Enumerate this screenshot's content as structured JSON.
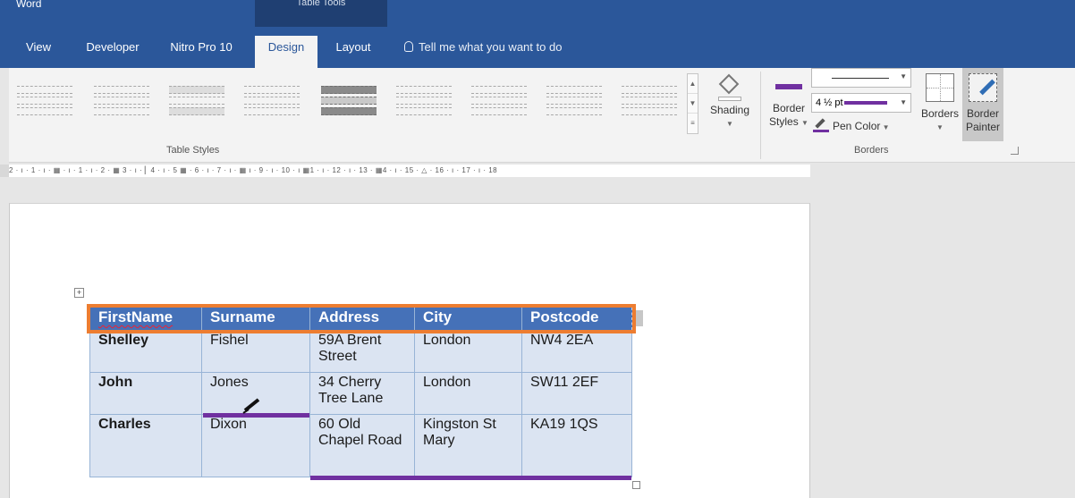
{
  "titlebar": {
    "app_name": "Word",
    "context_label": "Table Tools"
  },
  "tabs": [
    {
      "label": "View",
      "active": false
    },
    {
      "label": "Developer",
      "active": false
    },
    {
      "label": "Nitro Pro 10",
      "active": false
    },
    {
      "label": "Design",
      "active": true
    },
    {
      "label": "Layout",
      "active": false
    }
  ],
  "tell_me": "Tell me what you want to do",
  "ribbon": {
    "table_styles_label": "Table Styles",
    "shading_label": "Shading",
    "border_styles_label1": "Border",
    "border_styles_label2": "Styles",
    "line_weight": "4 ½ pt",
    "pen_color_label": "Pen Color",
    "borders_label": "Borders",
    "border_painter_label1": "Border",
    "border_painter_label2": "Painter",
    "borders_group_label": "Borders",
    "pen_color": "#7030a0"
  },
  "ruler_text": "2 · ı · 1 · ı · ▦ · ı · 1 · ı · 2 · ▦ 3 · ı · ▏4 · ı · 5 ▦ · 6 · ı · 7 · ı · ▦ ı · 9 · ı · 10 · ı ▦1 · ı · 12 · ı · 13 · ▦4 · ı · 15 · △ · 16 · ı · 17 · ı · 18",
  "table": {
    "headers": [
      "FirstName",
      "Surname",
      "Address",
      "City",
      "Postcode"
    ],
    "rows": [
      [
        "Shelley",
        "Fishel",
        "59A Brent Street",
        "London",
        "NW4 2EA"
      ],
      [
        "John",
        "Jones",
        "34 Cherry Tree Lane",
        "London",
        "SW11 2EF"
      ],
      [
        "Charles",
        "Dixon",
        "60 Old Chapel Road",
        "Kingston St Mary",
        "KA19 1QS"
      ]
    ]
  },
  "colors": {
    "ribbon_blue": "#2b579a",
    "highlight_orange": "#ed7d31",
    "border_purple": "#7030a0",
    "header_fill": "#4571b8"
  }
}
